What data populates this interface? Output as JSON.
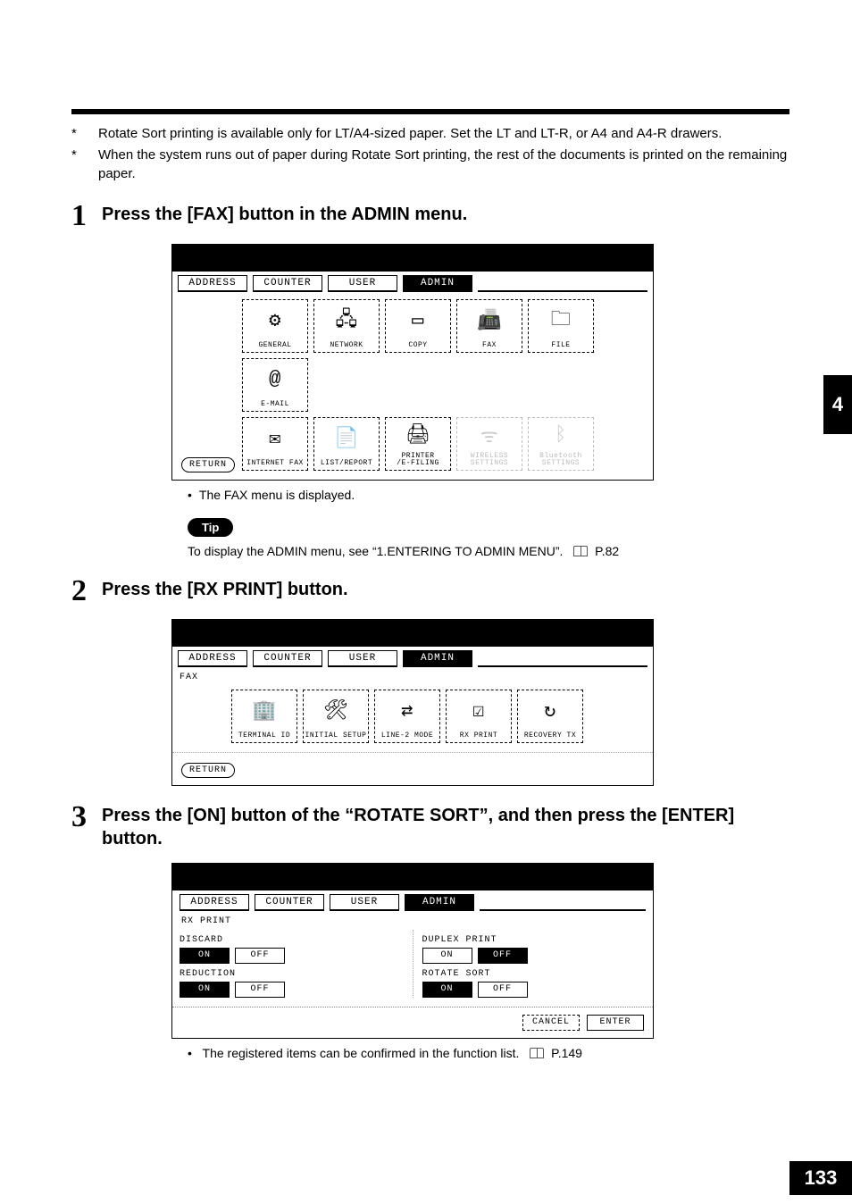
{
  "notes": {
    "a": "Rotate Sort printing is available only for LT/A4-sized paper. Set the LT and LT-R, or A4 and A4-R drawers.",
    "b": "When the system runs out of paper during Rotate Sort printing, the rest of the documents is printed on the remaining paper."
  },
  "steps": {
    "s1": {
      "num": "1",
      "title": "Press the [FAX] button in the ADMIN menu.",
      "sub": "The FAX menu is displayed."
    },
    "s2": {
      "num": "2",
      "title": "Press the [RX PRINT] button."
    },
    "s3": {
      "num": "3",
      "title": "Press the [ON] button of the “ROTATE SORT”, and then press the [ENTER] button.",
      "sub": "The registered items can be confirmed in the function list."
    }
  },
  "tip": {
    "badge": "Tip",
    "text": "To display the ADMIN menu, see “1.ENTERING TO ADMIN MENU”.",
    "ref": "P.82"
  },
  "ref149": "P.149",
  "sideTab": "4",
  "pageNum": "133",
  "tabs": {
    "address": "ADDRESS",
    "counter": "COUNTER",
    "user": "USER",
    "admin": "ADMIN"
  },
  "shot1": {
    "row1": {
      "general": "GENERAL",
      "network": "NETWORK",
      "copy": "COPY",
      "fax": "FAX",
      "file": "FILE",
      "email": "E-MAIL"
    },
    "row2": {
      "ifax": "INTERNET FAX",
      "list": "LIST/REPORT",
      "printer": "PRINTER\n/E-FILING",
      "wifi": "WIRELESS\nSETTINGS",
      "bt": "Bluetooth\nSETTINGS"
    },
    "return": "RETURN"
  },
  "shot2": {
    "crumb": "FAX",
    "btns": {
      "tid": "TERMINAL ID",
      "init": "INITIAL SETUP",
      "line2": "LINE-2 MODE",
      "rx": "RX PRINT",
      "rec": "RECOVERY TX"
    },
    "return": "RETURN"
  },
  "shot3": {
    "crumb": "RX PRINT",
    "labels": {
      "discard": "DISCARD",
      "reduction": "REDUCTION",
      "duplex": "DUPLEX PRINT",
      "rotate": "ROTATE SORT"
    },
    "on": "ON",
    "off": "OFF",
    "cancel": "CANCEL",
    "enter": "ENTER"
  }
}
